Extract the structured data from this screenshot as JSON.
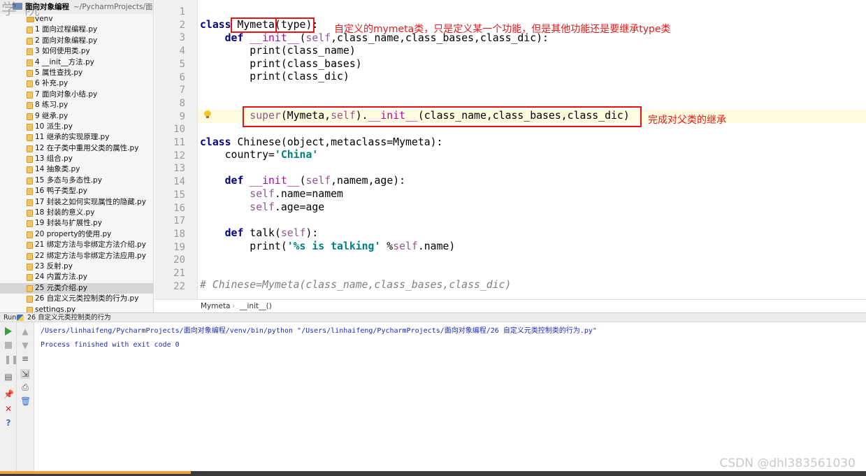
{
  "project": {
    "name": "面向对象编程",
    "path": "~/PycharmProjects/面向",
    "watermark": "学 院",
    "gutter_letters": "c\nc"
  },
  "tree": [
    {
      "label": "venv",
      "type": "folder"
    },
    {
      "label": "1 面向过程编程.py",
      "type": "file"
    },
    {
      "label": "2 面向对象编程.py",
      "type": "file"
    },
    {
      "label": "3 如何使用类.py",
      "type": "file"
    },
    {
      "label": "4 __init__方法.py",
      "type": "file"
    },
    {
      "label": "5 属性查找.py",
      "type": "file"
    },
    {
      "label": "6 补充.py",
      "type": "file"
    },
    {
      "label": "7 面向对象小结.py",
      "type": "file"
    },
    {
      "label": "8 练习.py",
      "type": "file"
    },
    {
      "label": "9 继承.py",
      "type": "file"
    },
    {
      "label": "10 派生.py",
      "type": "file"
    },
    {
      "label": "11 继承的实现原理.py",
      "type": "file"
    },
    {
      "label": "12 在子类中重用父类的属性.py",
      "type": "file"
    },
    {
      "label": "13 组合.py",
      "type": "file"
    },
    {
      "label": "14 抽象类.py",
      "type": "file"
    },
    {
      "label": "15 多态与多态性.py",
      "type": "file"
    },
    {
      "label": "16 鸭子类型.py",
      "type": "file"
    },
    {
      "label": "17 封装之如何实现属性的隐藏.py",
      "type": "file"
    },
    {
      "label": "18 封装的意义.py",
      "type": "file"
    },
    {
      "label": "19 封装与扩展性.py",
      "type": "file"
    },
    {
      "label": "20 property的使用.py",
      "type": "file"
    },
    {
      "label": "21 绑定方法与非绑定方法介绍.py",
      "type": "file"
    },
    {
      "label": "22 绑定方法与非绑定方法应用.py",
      "type": "file"
    },
    {
      "label": "23 反射.py",
      "type": "file"
    },
    {
      "label": "24 内置方法.py",
      "type": "file"
    },
    {
      "label": "25 元类介绍.py",
      "type": "file",
      "selected": true
    },
    {
      "label": "26 自定义元类控制类的行为.py",
      "type": "file"
    },
    {
      "label": "settings.py",
      "type": "file"
    }
  ],
  "editor": {
    "line_numbers": [
      "1",
      "2",
      "3",
      "4",
      "5",
      "6",
      "7",
      "8",
      "9",
      "10",
      "11",
      "12",
      "13",
      "14",
      "15",
      "16",
      "17",
      "18",
      "19",
      "20",
      "21",
      "22"
    ],
    "annotations": {
      "mymeta_note": "自定义的mymeta类，只是定义某一个功能，但是其他功能还是要继承type类",
      "super_note": "完成对父类的继承"
    },
    "code": {
      "l2": {
        "kw": "class",
        "name": "Mymeta",
        "base": "(type)",
        "colon": ":"
      },
      "l3": {
        "def": "def",
        "fn": "__init__",
        "open": "(",
        "self": "self",
        "rest": ",class_name,class_bases,class_dic):"
      },
      "l4": "print(class_name)",
      "l5": "print(class_bases)",
      "l6": "print(class_dic)",
      "l9": {
        "super": "super",
        "a": "(Mymeta,",
        "self": "self",
        "b": ").",
        "init": "__init__",
        "c": "(class_name,class_bases,class_dic)"
      },
      "l11": {
        "kw": "class",
        "name": "Chinese(object,metaclass=Mymeta):"
      },
      "l12": {
        "a": "country=",
        "str": "'China'"
      },
      "l14": {
        "def": "def",
        "fn": "__init__",
        "open": "(",
        "self": "self",
        "rest": ",namem,age):"
      },
      "l15": {
        "self": "self",
        "rest": ".name=namem"
      },
      "l16": {
        "self": "self",
        "rest": ".age=age"
      },
      "l18": {
        "def": "def",
        "fn": "talk",
        "open": "(",
        "self": "self",
        "rest": "):"
      },
      "l19": {
        "a": "print(",
        "str": "'%s is talking'",
        "b": " %",
        "self": "self",
        "c": ".name)"
      },
      "l22": "# Chinese=Mymeta(class_name,class_bases,class_dic)"
    },
    "breadcrumb": [
      "Mymeta",
      "__init__()"
    ],
    "breadcrumb_sep": "›"
  },
  "run": {
    "label": "Run",
    "config": "26 自定义元类控制类的行为",
    "output_path": "/Users/linhaifeng/PycharmProjects/面向对象编程/venv/bin/python \"/Users/linhaifeng/PycharmProjects/面向对象编程/26 自定义元类控制类的行为.py\"",
    "output_done": "Process finished with exit code 0",
    "progress_fraction": 0.22
  },
  "footer": {
    "watermark": "CSDN @dhl383561030"
  },
  "colors": {
    "keyword": "#000080",
    "self": "#94558d",
    "string": "#008080",
    "annotation": "#e21b1b",
    "console_text": "#1c2bbd"
  }
}
